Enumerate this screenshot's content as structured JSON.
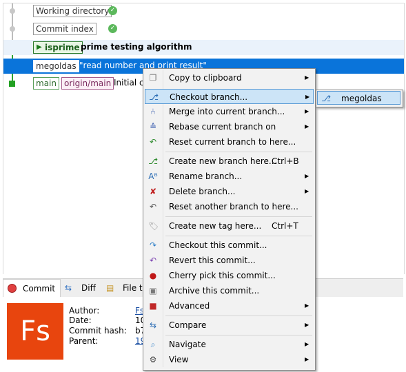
{
  "graph": {
    "rows": [
      {
        "tag": "Working directory"
      },
      {
        "tag": "Commit index"
      },
      {
        "branch": "isprime",
        "message": "prime testing algorithm"
      },
      {
        "branch": "megoldas",
        "message": "\"read number and print result\""
      },
      {
        "branch": "main",
        "remote": "origin/main",
        "message": "Initial co"
      }
    ]
  },
  "tabs": [
    {
      "label": "Commit"
    },
    {
      "label": "Diff"
    },
    {
      "label": "File tr"
    }
  ],
  "details": {
    "avatar": "Fs",
    "labels": [
      "Author:",
      "Date:",
      "Commit hash:",
      "Parent:"
    ],
    "values": [
      "Fs",
      "10",
      "b7",
      "19"
    ]
  },
  "menu": {
    "items": [
      {
        "label": "Copy to clipboard",
        "icon": "copy-icon"
      },
      {
        "label": "Checkout branch...",
        "icon": "checkout-icon"
      },
      {
        "label": "Merge into current branch...",
        "icon": "merge-icon"
      },
      {
        "label": "Rebase current branch on",
        "icon": "rebase-icon"
      },
      {
        "label": "Reset current branch to here...",
        "icon": "reset-icon"
      },
      {
        "label": "Create new branch here...",
        "shortcut": "Ctrl+B",
        "icon": "new-branch-icon"
      },
      {
        "label": "Rename branch...",
        "icon": "rename-branch-icon"
      },
      {
        "label": "Delete branch...",
        "icon": "delete-branch-icon"
      },
      {
        "label": "Reset another branch to here...",
        "icon": "reset-another-icon"
      },
      {
        "label": "Create new tag here...",
        "shortcut": "Ctrl+T",
        "icon": "tag-icon"
      },
      {
        "label": "Checkout this commit...",
        "icon": "checkout-commit-icon"
      },
      {
        "label": "Revert this commit...",
        "icon": "revert-icon"
      },
      {
        "label": "Cherry pick this commit...",
        "icon": "cherry-icon"
      },
      {
        "label": "Archive this commit...",
        "icon": "archive-icon"
      },
      {
        "label": "Advanced",
        "icon": "toolbox-icon"
      },
      {
        "label": "Compare",
        "icon": "compare-icon"
      },
      {
        "label": "Navigate",
        "icon": "navigate-icon"
      },
      {
        "label": "View",
        "icon": "view-icon"
      }
    ],
    "submenu": {
      "label": "megoldas",
      "icon": "branch-icon"
    }
  },
  "colors": {
    "selection": "#0a74da",
    "menu_highlight": "#cce4f7",
    "avatar": "#e8450e"
  }
}
